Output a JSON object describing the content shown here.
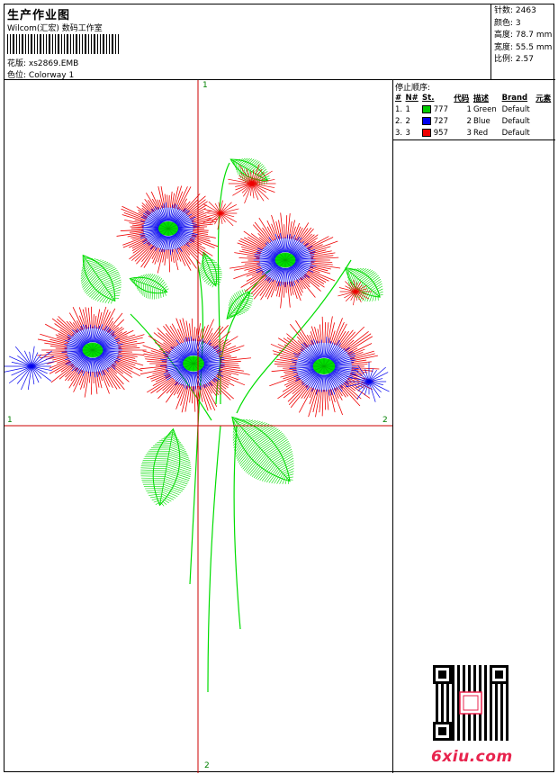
{
  "header": {
    "title": "生产作业图",
    "company": "Wilcom(汇宏) 数码工作室",
    "design_label": "花版:",
    "design_file": "xs2869.EMB",
    "colorway_label": "色位:",
    "colorway": "Colorway 1"
  },
  "stats": [
    {
      "label": "针数:",
      "value": "2463"
    },
    {
      "label": "颜色:",
      "value": "3"
    },
    {
      "label": "高度:",
      "value": "78.7 mm"
    },
    {
      "label": "宽度:",
      "value": "55.5 mm"
    },
    {
      "label": "比例:",
      "value": "2.57"
    }
  ],
  "sequence": {
    "title": "停止顺序:",
    "headers": [
      "#",
      "N#",
      "St.",
      "代码",
      "描述",
      "Brand",
      "元素"
    ],
    "rows": [
      {
        "index": "1.",
        "n": "1",
        "stitches": "777",
        "code": "1",
        "desc": "Green",
        "brand": "Default",
        "color": "#00cc00"
      },
      {
        "index": "2.",
        "n": "2",
        "stitches": "727",
        "code": "2",
        "desc": "Blue",
        "brand": "Default",
        "color": "#0000ee"
      },
      {
        "index": "3.",
        "n": "3",
        "stitches": "957",
        "code": "3",
        "desc": "Red",
        "brand": "Default",
        "color": "#ee0000"
      }
    ]
  },
  "axes": {
    "top": "1",
    "left": "1",
    "right": "2",
    "bottom": "2",
    "color": "#cc0000"
  },
  "watermark": {
    "text": "6xiu.com"
  },
  "colors": {
    "green": "#00dd00",
    "blue": "#0000ee",
    "red": "#ee0000"
  }
}
